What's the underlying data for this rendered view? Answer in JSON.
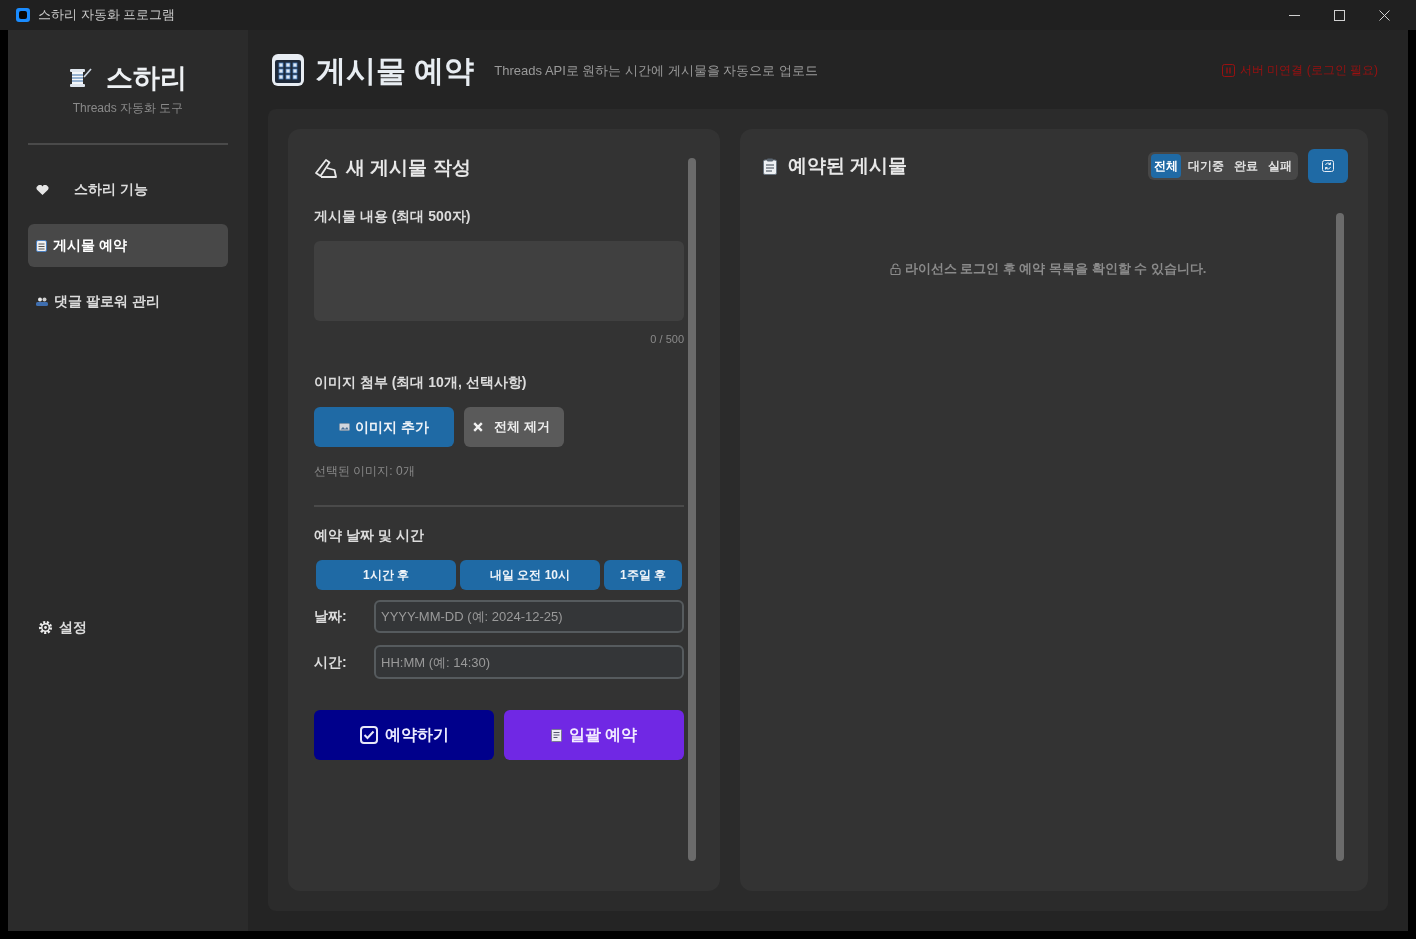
{
  "window": {
    "title": "스하리 자동화 프로그램"
  },
  "sidebar": {
    "app_name": "스하리",
    "tagline": "Threads 자동화 도구",
    "nav_items": [
      {
        "label": "스하리 기능",
        "selected": false
      },
      {
        "label": "게시물 예약",
        "selected": true
      },
      {
        "label": "댓글 팔로워 관리",
        "selected": false
      }
    ],
    "settings": {
      "label": "설정"
    }
  },
  "header": {
    "title": "게시물 예약",
    "subtitle": "Threads API로 원하는 시간에 게시물을 자동으로 업로드",
    "status": "서버 미연결 (로그인 필요)"
  },
  "compose": {
    "title": "새 게시물 작성",
    "content_label": "게시물 내용 (최대 500자)",
    "char_count": "0 / 500",
    "image_label": "이미지 첨부 (최대 10개, 선택사항)",
    "add_image_button": "이미지 추가",
    "remove_all_button": "전체 제거",
    "selected_images": "선택된 이미지: 0개",
    "schedule_label": "예약 날짜 및 시간",
    "quick_buttons": [
      "1시간 후",
      "내일 오전 10시",
      "1주일 후"
    ],
    "fields": [
      {
        "label": "날짜:",
        "placeholder": "YYYY-MM-DD (예: 2024-12-25)"
      },
      {
        "label": "시간:",
        "placeholder": "HH:MM (예: 14:30)"
      }
    ],
    "schedule_button": "예약하기",
    "bulk_button": "일괄 예약"
  },
  "scheduled": {
    "title": "예약된 게시물",
    "filters": [
      {
        "label": "전체",
        "selected": true
      },
      {
        "label": "대기중",
        "selected": false
      },
      {
        "label": "완료",
        "selected": false
      },
      {
        "label": "실패",
        "selected": false
      }
    ],
    "empty_message": "라이선스 로그인 후 예약 목록을 확인할 수 있습니다."
  }
}
